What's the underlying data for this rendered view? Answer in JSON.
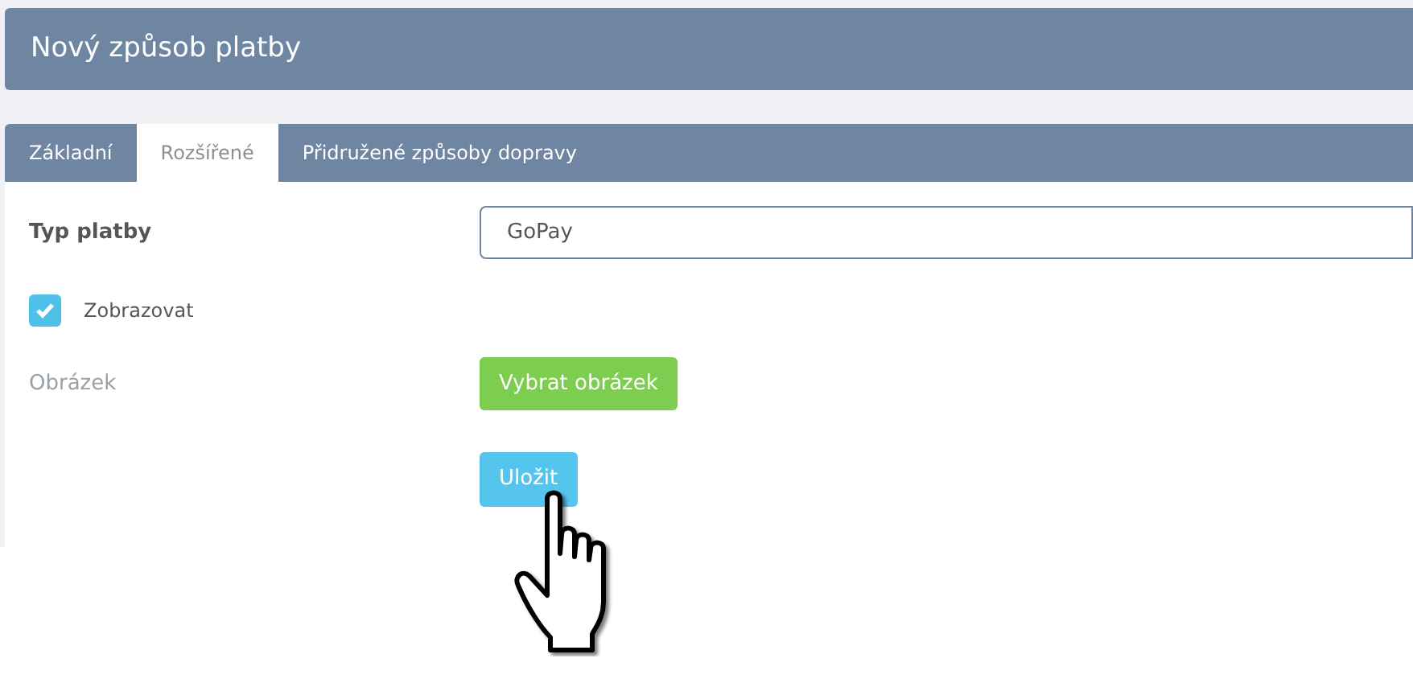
{
  "header": {
    "title": "Nový způsob platby"
  },
  "tabs": [
    {
      "label": "Základní",
      "selected": false
    },
    {
      "label": "Rozšířené",
      "selected": true
    },
    {
      "label": "Přidružené způsoby dopravy",
      "selected": false
    }
  ],
  "payment_type": {
    "label": "Typ platby",
    "value": "GoPay"
  },
  "display": {
    "label": "Zobrazovat",
    "checked": true
  },
  "image": {
    "label": "Obrázek",
    "button": "Vybrat obrázek"
  },
  "save_button": "Uložit"
}
